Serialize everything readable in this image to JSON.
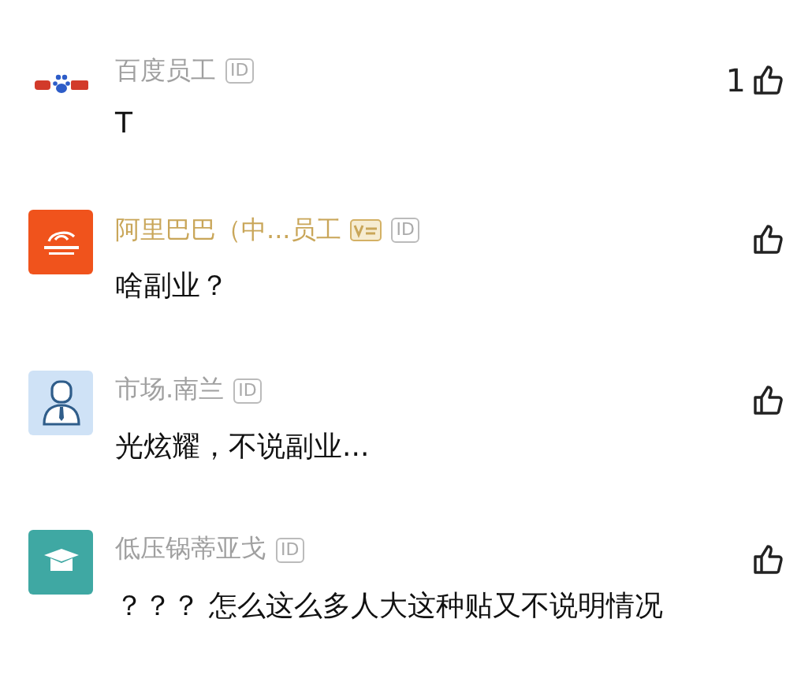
{
  "comments": [
    {
      "avatar": {
        "kind": "paw"
      },
      "name": "百度员工",
      "verified": false,
      "id_badge": "ID",
      "likes": "1",
      "text": "T"
    },
    {
      "avatar": {
        "kind": "swirl"
      },
      "name": "阿里巴巴（中...员工",
      "verified": true,
      "id_badge": "ID",
      "text": "啥副业？"
    },
    {
      "avatar": {
        "kind": "person"
      },
      "name": "市场.南兰",
      "verified": false,
      "id_badge": "ID",
      "text": "光炫耀，不说副业..."
    },
    {
      "avatar": {
        "kind": "cap"
      },
      "name": "低压锅蒂亚戈",
      "verified": false,
      "id_badge": "ID",
      "text": "？？？ 怎么这么多人大这种贴又不说明情况"
    }
  ]
}
